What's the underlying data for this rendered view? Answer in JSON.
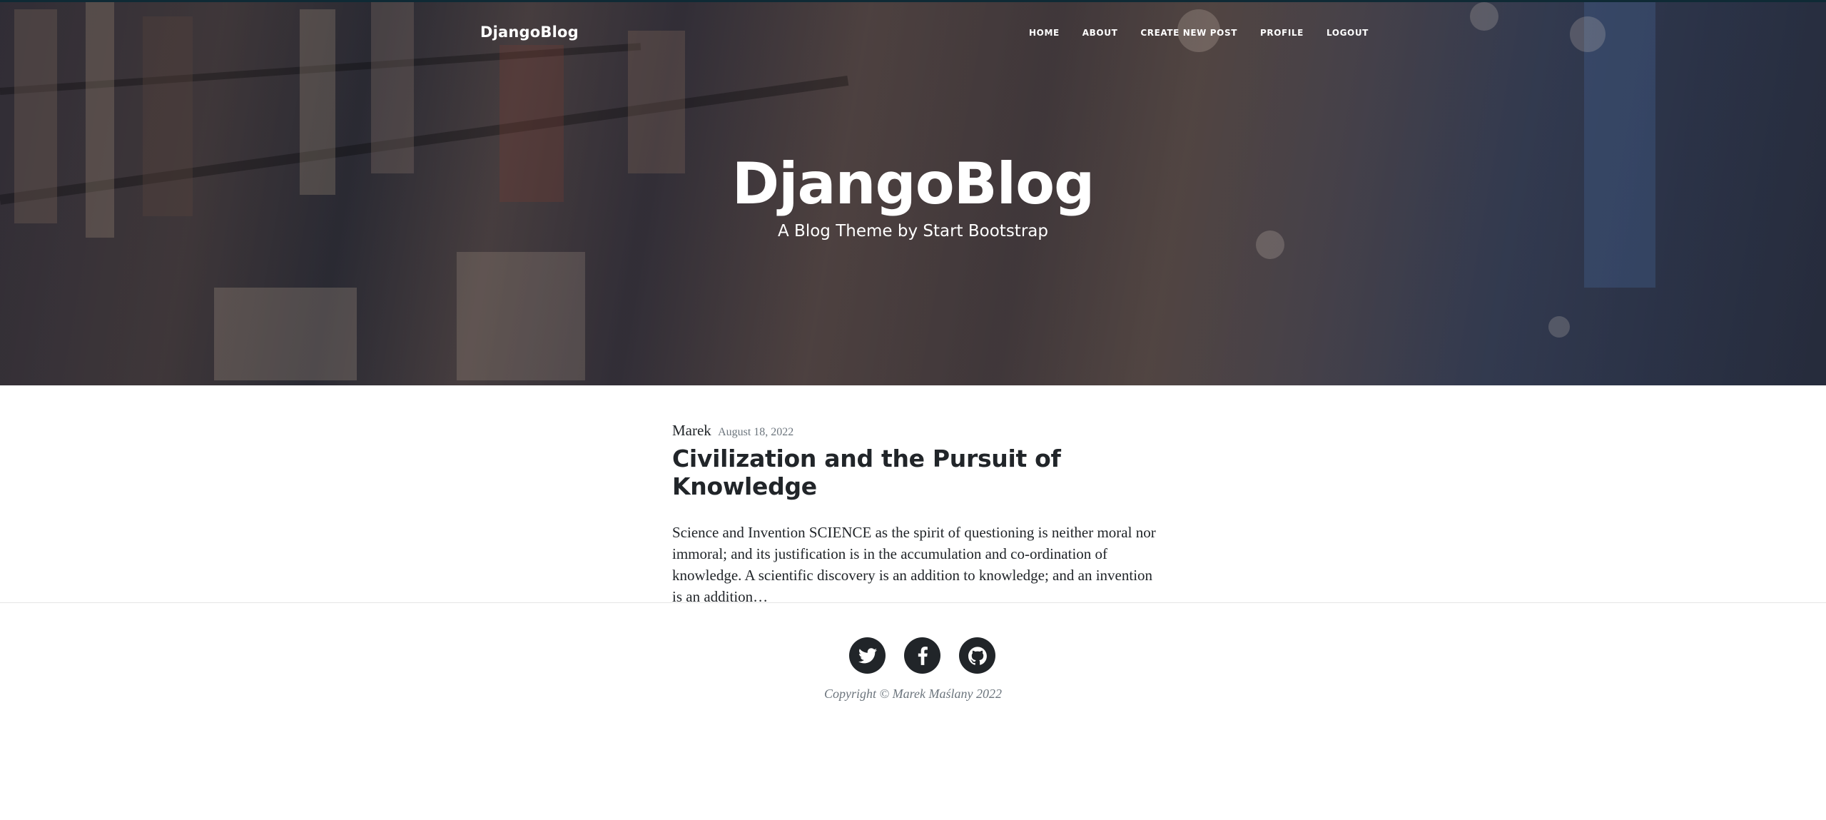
{
  "nav": {
    "brand": "DjangoBlog",
    "items": [
      {
        "label": "HOME"
      },
      {
        "label": "ABOUT"
      },
      {
        "label": "CREATE NEW POST"
      },
      {
        "label": "PROFILE"
      },
      {
        "label": "LOGOUT"
      }
    ]
  },
  "hero": {
    "title": "DjangoBlog",
    "subtitle": "A Blog Theme by Start Bootstrap"
  },
  "post": {
    "author": "Marek",
    "date": "August 18, 2022",
    "title": "Civilization and the Pursuit of Knowledge",
    "excerpt": "Science and Invention SCIENCE as the spirit of questioning is neither moral nor immoral; and its justification is in the accumulation and co-ordination of knowledge. A scientific discovery is an addition to knowledge; and an invention is an addition…"
  },
  "footer": {
    "social": [
      {
        "icon": "twitter-icon"
      },
      {
        "icon": "facebook-icon"
      },
      {
        "icon": "github-icon"
      }
    ],
    "copyright": "Copyright © Marek Maślany 2022"
  },
  "colors": {
    "text": "#212529",
    "muted": "#6c757d",
    "social_bg": "#212529"
  }
}
